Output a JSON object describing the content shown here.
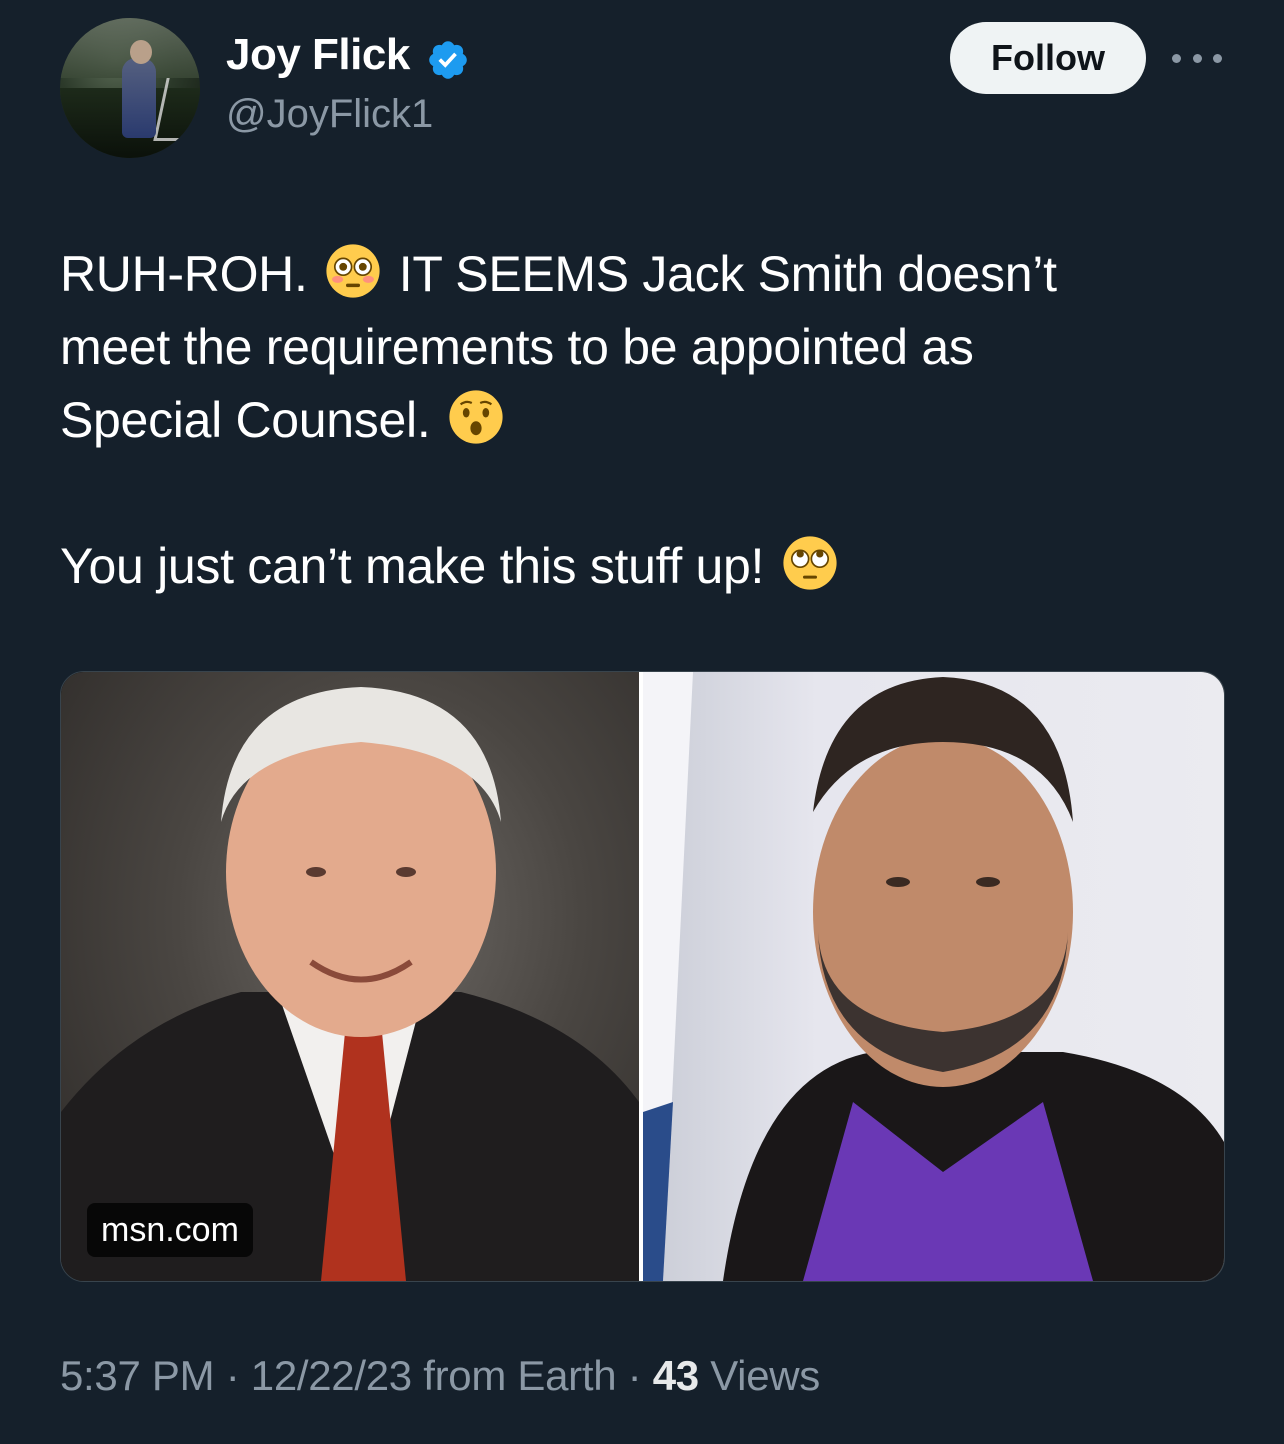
{
  "user": {
    "name": "Joy Flick",
    "handle": "@JoyFlick1",
    "verified": true,
    "verified_color": "#1d9bf0"
  },
  "actions": {
    "follow_label": "Follow",
    "more_icon": "more-horizontal-icon"
  },
  "tweet": {
    "line1_a": "RUH-ROH.",
    "line1_emoji": "flushed-face",
    "line1_b": "IT SEEMS Jack Smith doesn’t",
    "line2": "meet the requirements to be appointed as",
    "line3": "Special Counsel.",
    "line3_emoji": "hushed-face",
    "line4": "You just can’t make this stuff up!",
    "line4_emoji": "rolling-eyes-face"
  },
  "media": {
    "source_badge": "msn.com"
  },
  "meta": {
    "time": "5:37 PM",
    "sep1": " · ",
    "date": "12/22/23",
    "from": " from Earth",
    "sep2": " · ",
    "views_count": "43",
    "views_label": " Views"
  },
  "colors": {
    "background": "#15202b",
    "muted_text": "#8b98a5",
    "button_bg": "#eff3f4"
  }
}
